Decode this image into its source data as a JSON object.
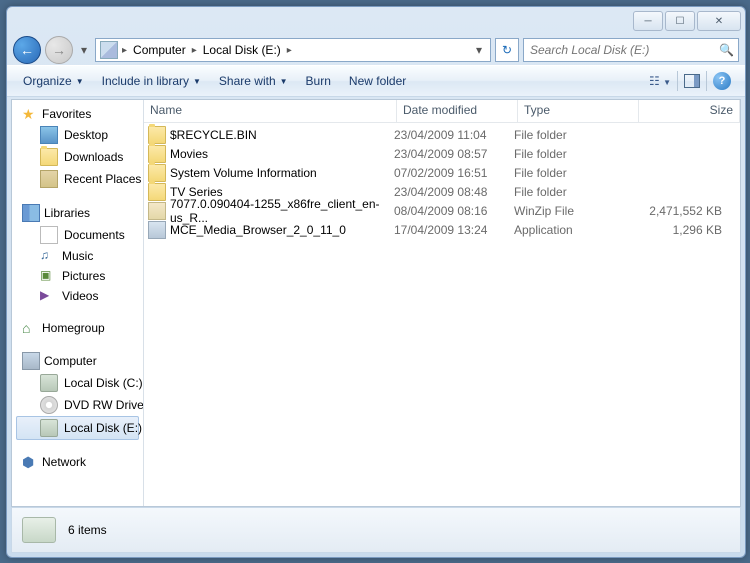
{
  "titlebar": {
    "min": "─",
    "max": "☐",
    "close": "✕"
  },
  "nav_buttons": {
    "back": "←",
    "forward": "→",
    "dropdown": "▾"
  },
  "breadcrumbs": [
    "Computer",
    "Local Disk (E:)"
  ],
  "address_dropdown": "▾",
  "refresh_icon": "↻",
  "search": {
    "placeholder": "Search Local Disk (E:)",
    "icon": "🔍"
  },
  "toolbar": {
    "organize": "Organize",
    "include": "Include in library",
    "share": "Share with",
    "burn": "Burn",
    "newfolder": "New folder",
    "dropdown": "▼"
  },
  "columns": {
    "name": "Name",
    "date": "Date modified",
    "type": "Type",
    "size": "Size",
    "sort": "▲"
  },
  "sidebar": {
    "favorites": {
      "label": "Favorites",
      "items": [
        "Desktop",
        "Downloads",
        "Recent Places"
      ]
    },
    "libraries": {
      "label": "Libraries",
      "items": [
        "Documents",
        "Music",
        "Pictures",
        "Videos"
      ]
    },
    "homegroup": {
      "label": "Homegroup"
    },
    "computer": {
      "label": "Computer",
      "items": [
        "Local Disk (C:)",
        "DVD RW Drive (D:)",
        "Local Disk (E:)"
      ]
    },
    "network": {
      "label": "Network"
    }
  },
  "files": [
    {
      "name": "$RECYCLE.BIN",
      "date": "23/04/2009 11:04",
      "type": "File folder",
      "size": "",
      "icon": "fold"
    },
    {
      "name": "Movies",
      "date": "23/04/2009 08:57",
      "type": "File folder",
      "size": "",
      "icon": "fold"
    },
    {
      "name": "System Volume Information",
      "date": "07/02/2009 16:51",
      "type": "File folder",
      "size": "",
      "icon": "fold"
    },
    {
      "name": "TV Series",
      "date": "23/04/2009 08:48",
      "type": "File folder",
      "size": "",
      "icon": "fold"
    },
    {
      "name": "7077.0.090404-1255_x86fre_client_en-us_R...",
      "date": "08/04/2009 08:16",
      "type": "WinZip File",
      "size": "2,471,552 KB",
      "icon": "zip"
    },
    {
      "name": "MCE_Media_Browser_2_0_11_0",
      "date": "17/04/2009 13:24",
      "type": "Application",
      "size": "1,296 KB",
      "icon": "exe"
    }
  ],
  "status": {
    "count": "6 items"
  }
}
